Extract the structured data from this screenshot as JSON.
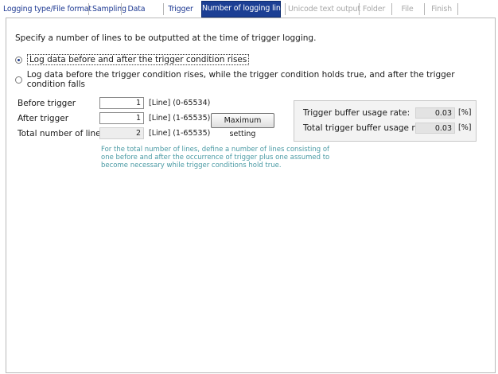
{
  "tabs": [
    {
      "label": "Logging type/File format",
      "state": "normal"
    },
    {
      "label": "Sampling",
      "state": "normal"
    },
    {
      "label": "Data",
      "state": "normal"
    },
    {
      "label": "Trigger",
      "state": "normal"
    },
    {
      "label": "Number of logging lines",
      "state": "active"
    },
    {
      "label": "Unicode text output",
      "state": "disabled"
    },
    {
      "label": "Folder",
      "state": "disabled"
    },
    {
      "label": "File",
      "state": "disabled"
    },
    {
      "label": "Finish",
      "state": "disabled"
    }
  ],
  "instruction": "Specify a number of lines to be outputted at the time of trigger logging.",
  "options": [
    {
      "label": "Log data before and after the trigger condition rises",
      "checked": true
    },
    {
      "label": "Log data before the trigger condition rises, while the trigger condition holds true, and after the trigger condition falls",
      "checked": false
    }
  ],
  "fields": {
    "before": {
      "label": "Before trigger",
      "value": "1",
      "unit": "[Line] (0-65534)"
    },
    "after": {
      "label": "After trigger",
      "value": "1",
      "unit": "[Line] (1-65535)"
    },
    "total": {
      "label": "Total number of lines",
      "value": "2",
      "unit": "[Line] (1-65535)"
    }
  },
  "max_button": "Maximum setting",
  "buffer": {
    "trigger_label": "Trigger buffer usage rate:",
    "trigger_value": "0.03",
    "total_label": "Total trigger buffer usage rate:",
    "total_value": "0.03",
    "unit": "[%]"
  },
  "note": [
    "For the total number of lines, define a number of lines consisting of",
    "one before and after the occurrence of trigger plus one assumed to",
    "become necessary while trigger conditions hold true."
  ],
  "colors": {
    "accent": "#1c3f94",
    "link": "#1f3a93",
    "note": "#4a9aa4",
    "disabled": "#a8a8a8"
  }
}
